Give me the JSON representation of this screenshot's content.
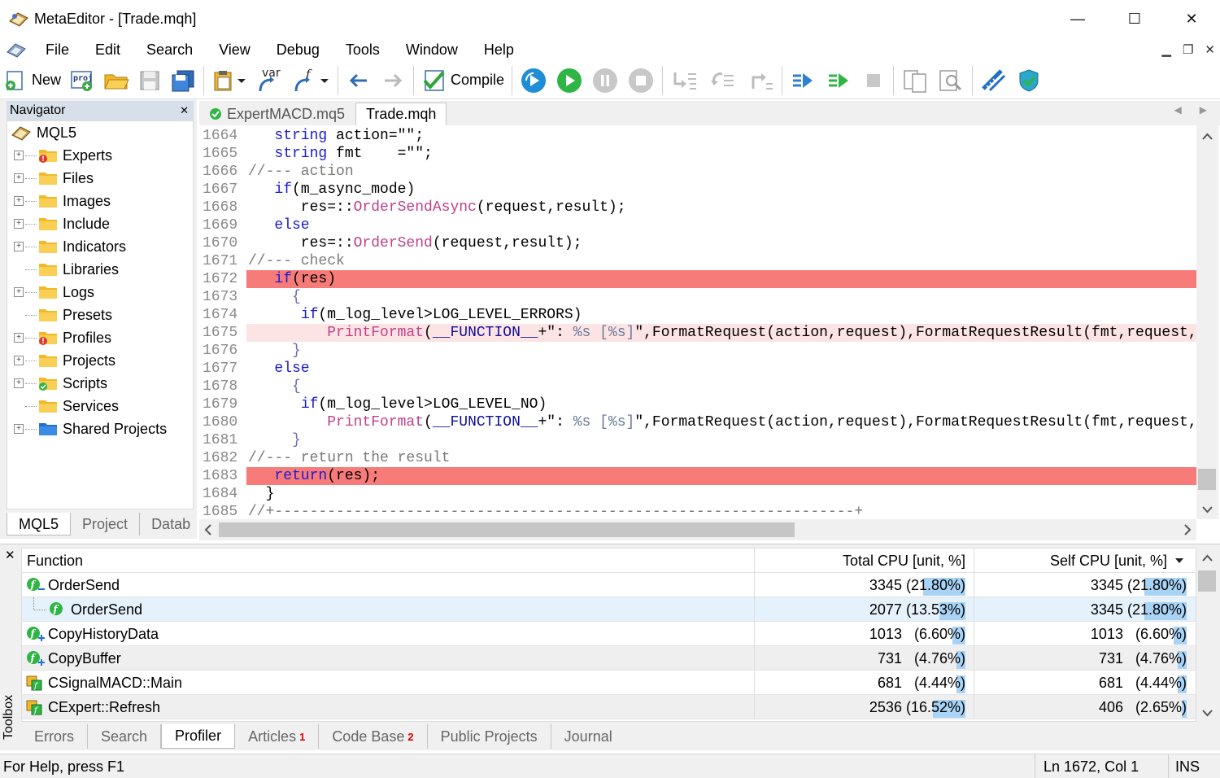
{
  "window": {
    "title": "MetaEditor - [Trade.mqh]",
    "minimize": "—",
    "maximize": "☐",
    "close": "✕"
  },
  "menu": {
    "items": [
      "File",
      "Edit",
      "Search",
      "View",
      "Debug",
      "Tools",
      "Window",
      "Help"
    ],
    "mdi_minimize": "▁",
    "mdi_restore": "❐",
    "mdi_close": "✕"
  },
  "toolbar": {
    "new_label": "New",
    "compile_label": "Compile",
    "var_label": "var"
  },
  "navigator": {
    "title": "Navigator",
    "close": "✕",
    "root": "MQL5",
    "items": [
      {
        "label": "Experts",
        "expandable": true,
        "badge": "error"
      },
      {
        "label": "Files",
        "expandable": true
      },
      {
        "label": "Images",
        "expandable": true
      },
      {
        "label": "Include",
        "expandable": true
      },
      {
        "label": "Indicators",
        "expandable": true
      },
      {
        "label": "Libraries",
        "expandable": false
      },
      {
        "label": "Logs",
        "expandable": true
      },
      {
        "label": "Presets",
        "expandable": false
      },
      {
        "label": "Profiles",
        "expandable": true,
        "badge": "error"
      },
      {
        "label": "Projects",
        "expandable": true
      },
      {
        "label": "Scripts",
        "expandable": true,
        "badge": "ok"
      },
      {
        "label": "Services",
        "expandable": false
      },
      {
        "label": "Shared Projects",
        "expandable": true,
        "blue": true
      }
    ],
    "tabs": [
      "MQL5",
      "Project",
      "Datab"
    ]
  },
  "editor": {
    "tabs": [
      "ExpertMACD.mq5",
      "Trade.mqh"
    ],
    "active_tab": "Trade.mqh"
  },
  "code_lines": [
    {
      "n": "1664",
      "parts": [
        [
          "",
          "   "
        ],
        [
          "kw",
          "string"
        ],
        [
          "nm",
          " action=\"\";"
        ]
      ]
    },
    {
      "n": "1665",
      "parts": [
        [
          "",
          "   "
        ],
        [
          "kw",
          "string"
        ],
        [
          "nm",
          " fmt    =\"\";"
        ]
      ]
    },
    {
      "n": "1666",
      "parts": [
        [
          "cm",
          "//--- action"
        ]
      ]
    },
    {
      "n": "1667",
      "parts": [
        [
          "",
          "   "
        ],
        [
          "kw",
          "if"
        ],
        [
          "nm",
          "(m_async_mode)"
        ]
      ]
    },
    {
      "n": "1668",
      "parts": [
        [
          "nm",
          "      res=::"
        ],
        [
          "fn",
          "OrderSendAsync"
        ],
        [
          "nm",
          "(request,result);"
        ]
      ]
    },
    {
      "n": "1669",
      "parts": [
        [
          "",
          "   "
        ],
        [
          "kw",
          "else"
        ]
      ]
    },
    {
      "n": "1670",
      "parts": [
        [
          "nm",
          "      res=::"
        ],
        [
          "fn",
          "OrderSend"
        ],
        [
          "nm",
          "(request,result);"
        ]
      ]
    },
    {
      "n": "1671",
      "parts": [
        [
          "cm",
          "//--- check"
        ]
      ]
    },
    {
      "n": "1672",
      "bp": true,
      "parts": [
        [
          "",
          "   "
        ],
        [
          "kw",
          "if"
        ],
        [
          "nm",
          "(res)"
        ]
      ]
    },
    {
      "n": "1673",
      "parts": [
        [
          "tl",
          "     {"
        ]
      ]
    },
    {
      "n": "1674",
      "parts": [
        [
          "",
          "      "
        ],
        [
          "kw",
          "if"
        ],
        [
          "nm",
          "(m_log_level>LOG_LEVEL_ERRORS)"
        ]
      ]
    },
    {
      "n": "1675",
      "hl": true,
      "parts": [
        [
          "",
          "         "
        ],
        [
          "fn",
          "PrintFormat"
        ],
        [
          "nm",
          "("
        ],
        [
          "pm",
          "__FUNCTION__"
        ],
        [
          "nm",
          "+\": "
        ],
        [
          "st",
          "%s [%s]"
        ],
        [
          "nm",
          "\",FormatRequest(action,request),FormatRequestResult(fmt,request,result));"
        ]
      ]
    },
    {
      "n": "1676",
      "parts": [
        [
          "tl",
          "     }"
        ]
      ]
    },
    {
      "n": "1677",
      "parts": [
        [
          "",
          "   "
        ],
        [
          "kw",
          "else"
        ]
      ]
    },
    {
      "n": "1678",
      "parts": [
        [
          "tl",
          "     {"
        ]
      ]
    },
    {
      "n": "1679",
      "parts": [
        [
          "",
          "      "
        ],
        [
          "kw",
          "if"
        ],
        [
          "nm",
          "(m_log_level>LOG_LEVEL_NO)"
        ]
      ]
    },
    {
      "n": "1680",
      "parts": [
        [
          "",
          "         "
        ],
        [
          "fn",
          "PrintFormat"
        ],
        [
          "nm",
          "("
        ],
        [
          "pm",
          "__FUNCTION__"
        ],
        [
          "nm",
          "+\": "
        ],
        [
          "st",
          "%s [%s]"
        ],
        [
          "nm",
          "\",FormatRequest(action,request),FormatRequestResult(fmt,request,result));"
        ]
      ]
    },
    {
      "n": "1681",
      "parts": [
        [
          "tl",
          "     }"
        ]
      ]
    },
    {
      "n": "1682",
      "parts": [
        [
          "cm",
          "//--- return the result"
        ]
      ]
    },
    {
      "n": "1683",
      "bp": true,
      "parts": [
        [
          "",
          "   "
        ],
        [
          "kw",
          "return"
        ],
        [
          "nm",
          "(res);"
        ]
      ]
    },
    {
      "n": "1684",
      "parts": [
        [
          "nm",
          "  }"
        ]
      ]
    },
    {
      "n": "1685",
      "parts": [
        [
          "cm",
          "//+------------------------------------------------------------------+"
        ]
      ]
    }
  ],
  "profiler": {
    "headers": {
      "function": "Function",
      "total": "Total CPU [unit, %]",
      "self": "Self CPU [unit, %]"
    },
    "rows": [
      {
        "fn": "OrderSend",
        "indent": 0,
        "total": "3345 (21.80%)",
        "total_pct": 21.8,
        "self": "3345 (21.80%)",
        "self_pct": 21.8,
        "icon": "collapse"
      },
      {
        "fn": "OrderSend",
        "indent": 1,
        "total": "2077 (13.53%)",
        "total_pct": 13.53,
        "self": "3345 (21.80%)",
        "self_pct": 21.8,
        "icon": "leaf",
        "selected": true
      },
      {
        "fn": "CopyHistoryData",
        "indent": 0,
        "total": "1013   (6.60%)",
        "total_pct": 6.6,
        "self": "1013   (6.60%)",
        "self_pct": 6.6,
        "icon": "expand"
      },
      {
        "fn": "CopyBuffer",
        "indent": 0,
        "total": "731   (4.76%)",
        "total_pct": 4.76,
        "self": "731   (4.76%)",
        "self_pct": 4.76,
        "icon": "expand",
        "alt": true
      },
      {
        "fn": "CSignalMACD::Main",
        "indent": 0,
        "total": "681   (4.44%)",
        "total_pct": 4.44,
        "self": "681   (4.44%)",
        "self_pct": 4.44,
        "icon": "method"
      },
      {
        "fn": "CExpert::Refresh",
        "indent": 0,
        "total": "2536 (16.52%)",
        "total_pct": 16.52,
        "self": "406   (2.65%)",
        "self_pct": 2.65,
        "icon": "method",
        "alt": true
      }
    ]
  },
  "toolbox": {
    "label": "Toolbox",
    "close": "✕",
    "tabs": [
      {
        "label": "Errors"
      },
      {
        "label": "Search"
      },
      {
        "label": "Profiler",
        "active": true
      },
      {
        "label": "Articles",
        "badge": "1"
      },
      {
        "label": "Code Base",
        "badge": "2"
      },
      {
        "label": "Public Projects"
      },
      {
        "label": "Journal"
      }
    ]
  },
  "status": {
    "help": "For Help, press F1",
    "position": "Ln 1672, Col 1",
    "mode": "INS"
  },
  "colors": {
    "breakpoint_line": "#f77b78",
    "selection": "#e5f1fb",
    "percent_bar": "#a9d3f5",
    "keyword": "#1a1ad6",
    "function": "#c0408a"
  }
}
